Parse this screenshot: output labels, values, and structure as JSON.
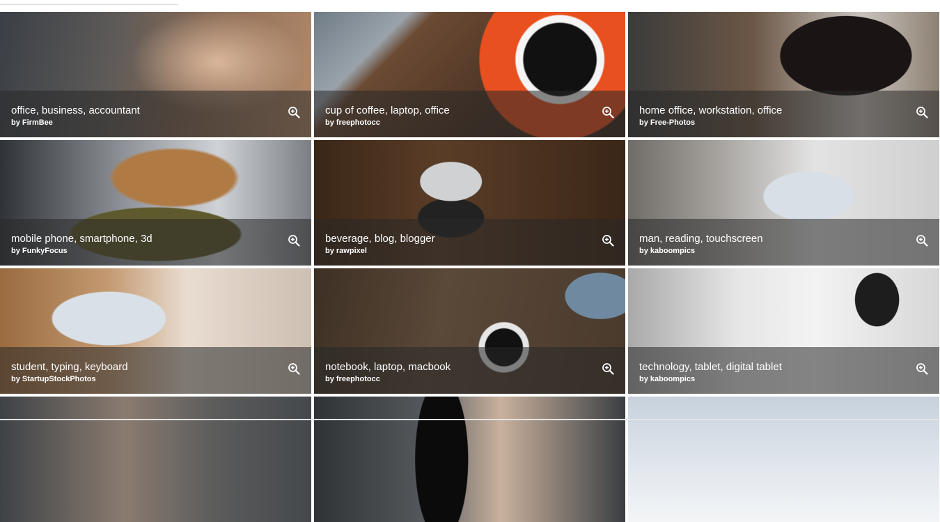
{
  "gallery": {
    "tiles": [
      {
        "tags": "office, business, accountant",
        "author": "by FirmBee"
      },
      {
        "tags": "cup of coffee, laptop, office",
        "author": "by freephotocc"
      },
      {
        "tags": "home office, workstation, office",
        "author": "by Free-Photos"
      },
      {
        "tags": "mobile phone, smartphone, 3d",
        "author": "by FunkyFocus"
      },
      {
        "tags": "beverage, blog, blogger",
        "author": "by rawpixel"
      },
      {
        "tags": "man, reading, touchscreen",
        "author": "by kaboompics"
      },
      {
        "tags": "student, typing, keyboard",
        "author": "by StartupStockPhotos"
      },
      {
        "tags": "notebook, laptop, macbook",
        "author": "by freephotocc"
      },
      {
        "tags": "technology, tablet, digital tablet",
        "author": "by kaboompics"
      }
    ],
    "zoom_icon": "zoom-in-icon",
    "caption_color": "#ffffff"
  }
}
